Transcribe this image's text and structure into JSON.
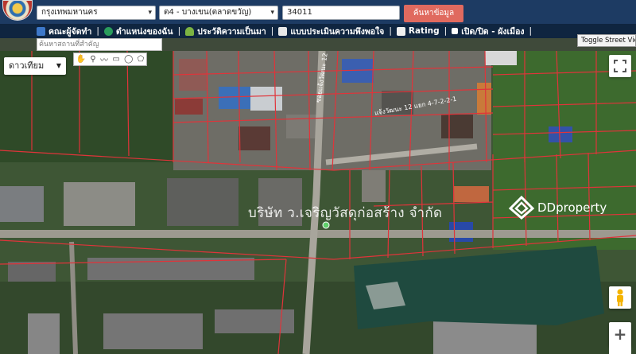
{
  "header": {
    "province_select": "กรุงเทพมหานคร",
    "district_select": "ต4 - บางเขน(ตลาดขวัญ)",
    "code_input": "34011",
    "search_button": "ค้นหาข้อมูล"
  },
  "menu": {
    "items": [
      {
        "label": "คณะผู้จัดทำ",
        "icon": "building-icon"
      },
      {
        "label": "ตำแหน่งของฉัน",
        "icon": "globe-icon"
      },
      {
        "label": "ประวัติความเป็นมา",
        "icon": "tree-icon"
      },
      {
        "label": "แบบประเมินความพึงพอใจ",
        "icon": "document-icon"
      },
      {
        "label": "Rating",
        "icon": "chart-icon"
      },
      {
        "label": "เปิด/ปิด - ผังเมือง",
        "icon": "square-icon"
      }
    ],
    "separator": "|"
  },
  "place_search": {
    "placeholder": "ค้นหาสถานที่สำคัญ"
  },
  "toggle_street_view": "Toggle Street View",
  "map": {
    "map_type": "ดาวเทียม",
    "road_label_1": "ซอยแจ้งวัฒนะ 12 แยก 4-7-2-1",
    "road_label_2": "แจ้งวัฒนะ 12 แยก 4-7-2-2-1",
    "watermark_company": "บริษัท  ว.เจริญวัสดุก่อสร้าง จำกัด",
    "watermark_brand": "DDproperty",
    "zoom_in": "+",
    "colors": {
      "parcel_lines": "#e0343a",
      "header_bg": "#1d3b63",
      "menu_bg": "#0f2540",
      "search_button": "#e06a5f"
    }
  }
}
